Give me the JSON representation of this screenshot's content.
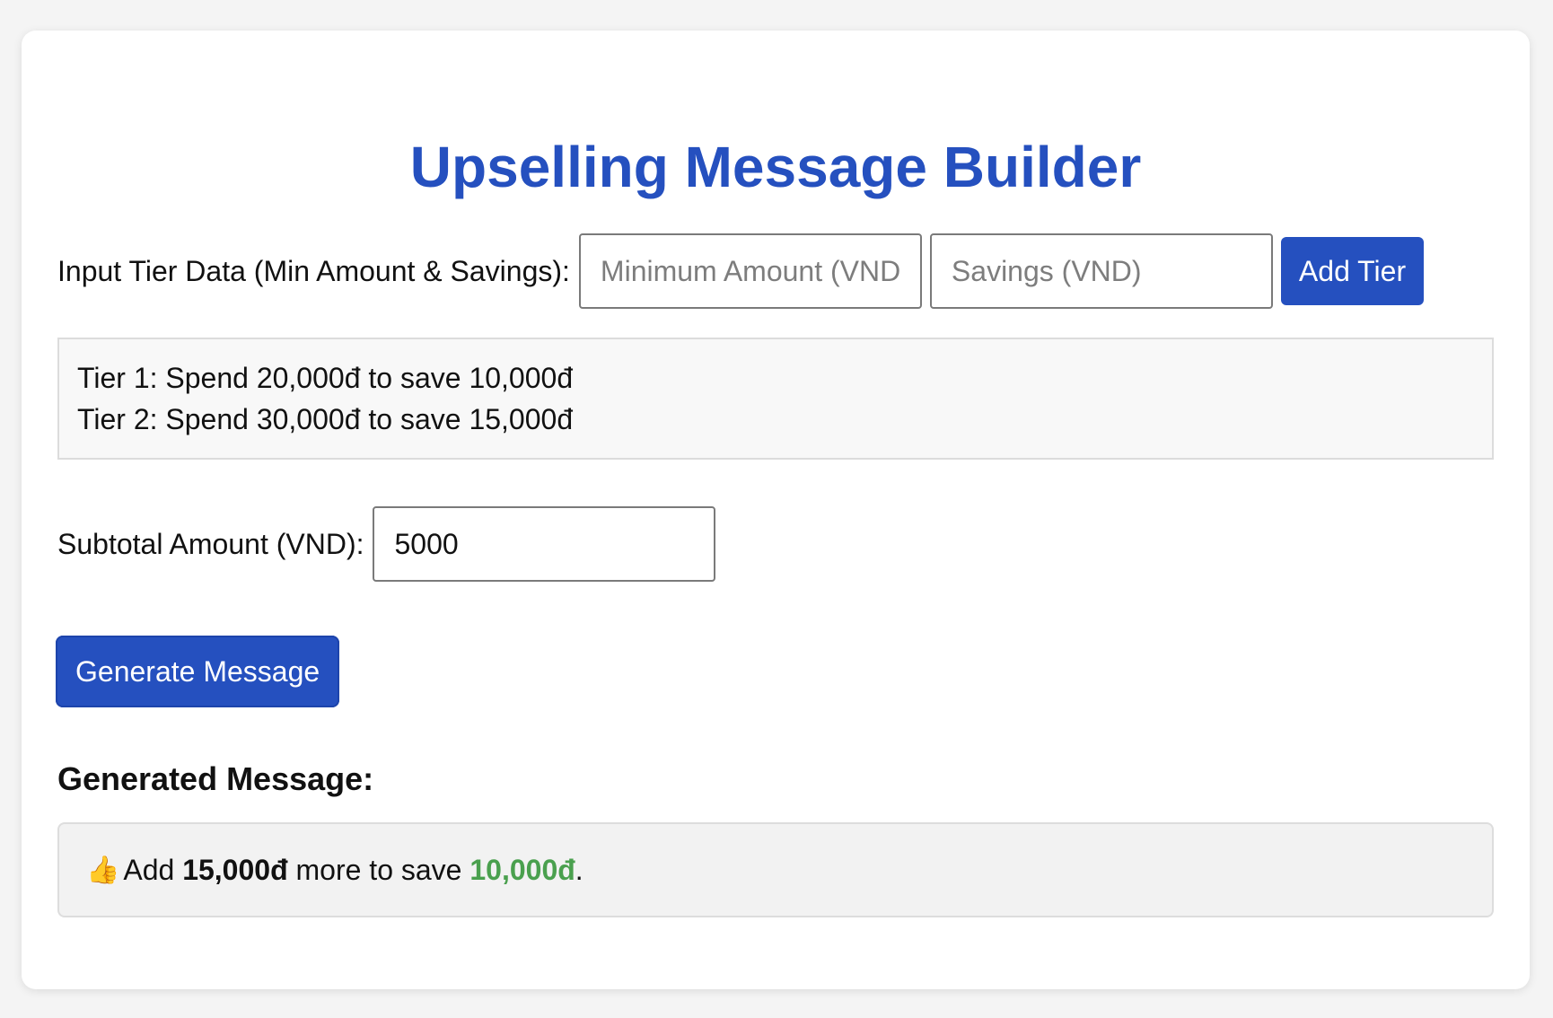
{
  "page": {
    "title": "Upselling Message Builder"
  },
  "tier_input": {
    "label": "Input Tier Data (Min Amount & Savings):",
    "min_placeholder": "Minimum Amount (VND)",
    "savings_placeholder": "Savings (VND)",
    "add_button": "Add Tier"
  },
  "tiers": [
    "Tier 1: Spend 20,000đ to save 10,000đ",
    "Tier 2: Spend 30,000đ to save 15,000đ"
  ],
  "subtotal": {
    "label": "Subtotal Amount (VND):",
    "value": "5000"
  },
  "generate_button": "Generate Message",
  "result": {
    "heading": "Generated Message:",
    "icon": "👍",
    "icon_name": "thumbs-up-icon",
    "prefix": "Add",
    "amount": "15,000đ",
    "middle": "more to save",
    "saving": "10,000đ",
    "suffix": "."
  },
  "colors": {
    "accent": "#2550bf",
    "saving_green": "#4aa04e"
  }
}
